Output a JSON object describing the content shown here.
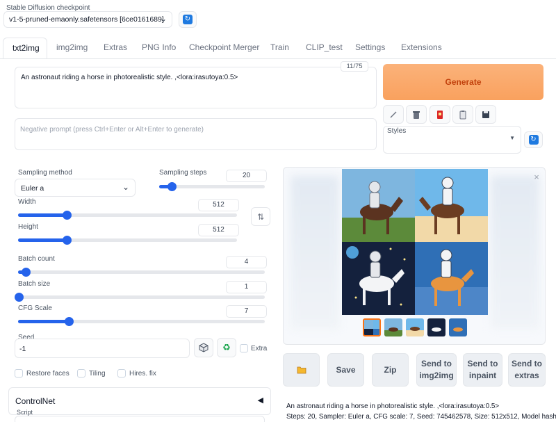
{
  "checkpoint": {
    "label": "Stable Diffusion checkpoint",
    "value": "v1-5-pruned-emaonly.safetensors [6ce0161689]"
  },
  "tabs": [
    "txt2img",
    "img2img",
    "Extras",
    "PNG Info",
    "Checkpoint Merger",
    "Train",
    "CLIP_test",
    "Settings",
    "Extensions"
  ],
  "prompt": {
    "text": "An astronaut riding a horse in photorealistic style. ,<lora:irasutoya:0.5>",
    "counter": "11/75",
    "negative_placeholder": "Negative prompt (press Ctrl+Enter or Alt+Enter to generate)"
  },
  "generate_label": "Generate",
  "styles_label": "Styles",
  "sampling": {
    "method_label": "Sampling method",
    "method_value": "Euler a",
    "steps_label": "Sampling steps",
    "steps_value": "20"
  },
  "size": {
    "width_label": "Width",
    "width_value": "512",
    "height_label": "Height",
    "height_value": "512",
    "swap_icon": "⇅"
  },
  "batch": {
    "count_label": "Batch count",
    "count_value": "4",
    "size_label": "Batch size",
    "size_value": "1"
  },
  "cfg": {
    "label": "CFG Scale",
    "value": "7"
  },
  "seed": {
    "label": "Seed",
    "value": "-1",
    "extra_label": "Extra"
  },
  "options": {
    "restore_faces": "Restore faces",
    "tiling": "Tiling",
    "hires_fix": "Hires. fix"
  },
  "controlnet": {
    "label": "ControlNet",
    "arrow": "◀"
  },
  "script_label": "Script",
  "actions": {
    "folder_icon": "folder-icon",
    "save": "Save",
    "zip": "Zip",
    "send_img2img_1": "Send to",
    "send_img2img_2": "img2img",
    "send_inpaint_1": "Send to",
    "send_inpaint_2": "inpaint",
    "send_extras_1": "Send to",
    "send_extras_2": "extras"
  },
  "info": {
    "line1": "An astronaut riding a horse in photorealistic style. ,<lora:irasutoya:0.5>",
    "line2": "Steps: 20, Sampler: Euler a, CFG scale: 7, Seed: 745462578, Size: 512x512, Model hash:"
  },
  "close_glyph": "×",
  "colors": {
    "generate": "#f9a15e",
    "accent_blue": "#2563eb",
    "refresh_blue": "#1f7ae0"
  }
}
